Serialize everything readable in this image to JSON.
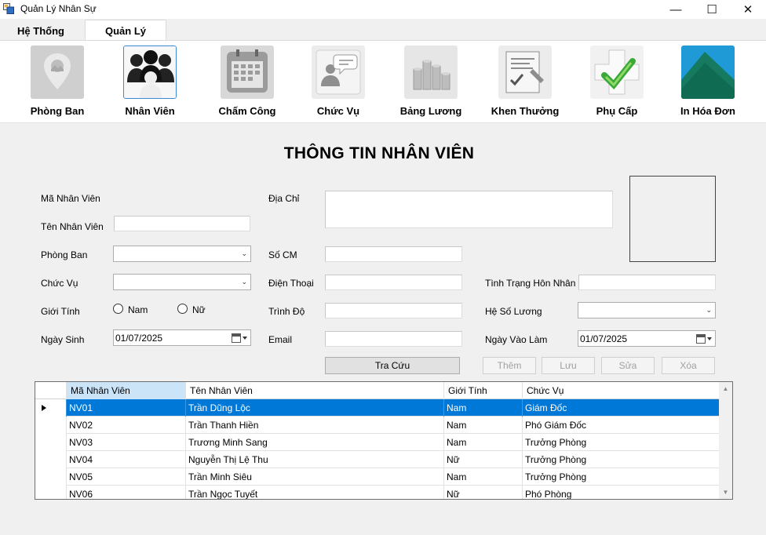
{
  "window": {
    "title": "Quản Lý Nhân Sự",
    "minimize": "—",
    "maximize": "☐",
    "close": "✕"
  },
  "tabs": [
    {
      "label": "Hệ Thống"
    },
    {
      "label": "Quản Lý"
    }
  ],
  "ribbon": [
    {
      "label": "Phòng Ban",
      "icon": "location-pin-icon"
    },
    {
      "label": "Nhân Viên",
      "icon": "people-group-icon"
    },
    {
      "label": "Chấm Công",
      "icon": "calendar-icon"
    },
    {
      "label": "Chức Vụ",
      "icon": "speaker-chat-icon"
    },
    {
      "label": "Bảng Lương",
      "icon": "coins-stack-icon"
    },
    {
      "label": "Khen Thưởng",
      "icon": "certificate-icon"
    },
    {
      "label": "Phụ Cấp",
      "icon": "medical-cross-check-icon"
    },
    {
      "label": "In Hóa Đơn",
      "icon": "mountain-icon"
    }
  ],
  "form": {
    "title": "THÔNG TIN NHÂN VIÊN",
    "labels": {
      "ma_nv": "Mã Nhân Viên",
      "ten_nv": "Tên Nhân Viên",
      "phong_ban": "Phòng Ban",
      "chuc_vu": "Chức Vụ",
      "gioi_tinh": "Giới Tính",
      "ngay_sinh": "Ngày Sinh",
      "dia_chi": "Địa Chỉ",
      "so_cm": "Số CM",
      "dien_thoai": "Điện Thoại",
      "trinh_do": "Trình Độ",
      "email": "Email",
      "hon_nhan": "Tình Trạng Hôn Nhân",
      "he_so_luong": "Hệ Số Lương",
      "ngay_vao_lam": "Ngày Vào Làm",
      "nam": "Nam",
      "nu": "Nữ"
    },
    "values": {
      "ngay_sinh": "01/07/2025",
      "ngay_vao_lam": "01/07/2025"
    },
    "buttons": {
      "tra_cuu": "Tra Cứu",
      "them": "Thêm",
      "luu": "Lưu",
      "sua": "Sửa",
      "xoa": "Xóa"
    }
  },
  "grid": {
    "columns": [
      "Mã Nhân Viên",
      "Tên Nhân Viên",
      "Giới Tính",
      "Chức Vụ"
    ],
    "rows": [
      {
        "ma": "NV01",
        "ten": "Trần Dũng Lộc",
        "gt": "Nam",
        "cv": "Giám Đốc"
      },
      {
        "ma": "NV02",
        "ten": "Trần Thanh Hiền",
        "gt": "Nam",
        "cv": "Phó Giám Đốc"
      },
      {
        "ma": "NV03",
        "ten": "Trương Minh Sang",
        "gt": "Nam",
        "cv": "Trưởng Phòng"
      },
      {
        "ma": "NV04",
        "ten": "Nguyễn Thị Lệ Thu",
        "gt": "Nữ",
        "cv": "Trưởng Phòng"
      },
      {
        "ma": "NV05",
        "ten": "Trần Minh Siêu",
        "gt": "Nam",
        "cv": "Trưởng Phòng"
      },
      {
        "ma": "NV06",
        "ten": "Trần Ngọc Tuyết",
        "gt": "Nữ",
        "cv": "Phó Phòng"
      }
    ]
  },
  "colors": {
    "selection": "#0078d7",
    "header_selected": "#cce4f7",
    "accent_border": "#3c8bd8"
  }
}
